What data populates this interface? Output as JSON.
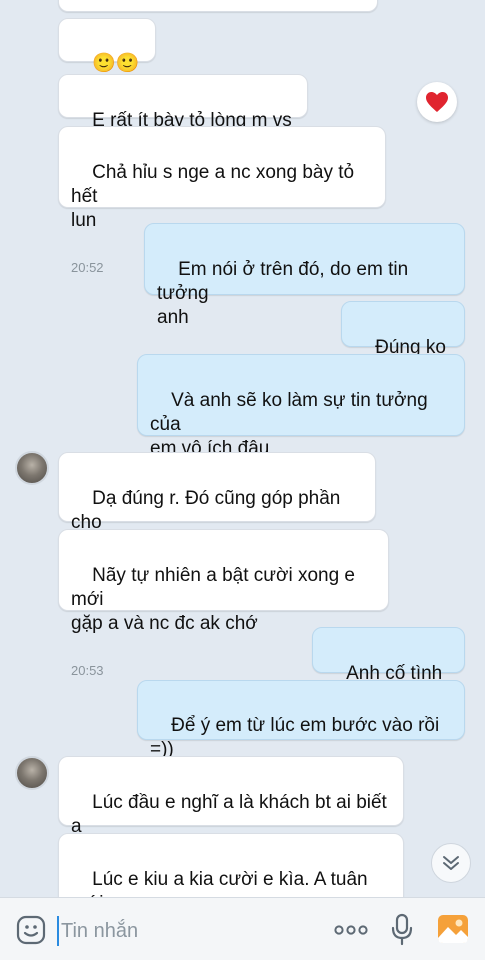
{
  "messages": [
    {
      "text": "🙂🙂🙂",
      "time": ""
    },
    {
      "text": "E rất ít bày tỏ lòng m vs ai",
      "time": ""
    },
    {
      "text": "Chả hỉu s nge a nc xong bày tỏ hết\nlun",
      "time": "20:52"
    },
    {
      "text": "Em nói ở trên đó, do em tin tưởng\nanh",
      "time": ""
    },
    {
      "text": "Đúng ko nè",
      "time": ""
    },
    {
      "text": "Và anh sẽ ko làm sự tin tưởng của\nem vô ích đâu",
      "time": "20:53"
    },
    {
      "text": "Dạ đúng r. Đó cũng góp phần cho\nbuổi trò chuyện hnay.",
      "time": ""
    },
    {
      "text": "Nãy tự nhiên a bật cười xong e mới\ngặp a và nc đc ak chớ",
      "time": "20:53"
    },
    {
      "text": "Anh cố tình =))",
      "time": ""
    },
    {
      "text": "Để ý em từ lúc em bước vào rồi =))",
      "time": "20:53"
    },
    {
      "text": "Lúc đầu e nghĩ a là khách bt ai biết a\nlà bạn a kia",
      "time": ""
    },
    {
      "text": "Lúc e kiu a kia cười e kìa. A tuân mới\nnói bạn a đó",
      "time": ""
    }
  ],
  "reaction": {
    "icon": "heart-icon",
    "color": "#e0242f"
  },
  "input": {
    "placeholder": "Tin nhắn"
  },
  "colors": {
    "incoming": "#ffffff",
    "outgoing": "#d4ecfb",
    "background": "#e2e9f1",
    "accent": "#2a8be0"
  }
}
